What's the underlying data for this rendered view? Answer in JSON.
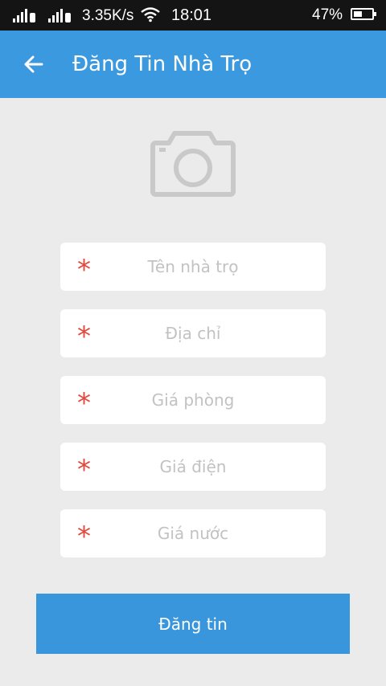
{
  "status_bar": {
    "sim1": "1",
    "sim2": "2",
    "network_speed": "3.35K/s",
    "time": "18:01",
    "battery_percent": "47%",
    "battery_level": 0.47
  },
  "app_bar": {
    "back_icon": "arrow-left-icon",
    "title": "Đăng Tin Nhà Trọ"
  },
  "photo": {
    "icon": "camera-icon"
  },
  "form": {
    "required_mark": "*",
    "fields": [
      {
        "placeholder": "Tên nhà trọ",
        "value": ""
      },
      {
        "placeholder": "Địa chỉ",
        "value": ""
      },
      {
        "placeholder": "Giá phòng",
        "value": ""
      },
      {
        "placeholder": "Giá điện",
        "value": ""
      },
      {
        "placeholder": "Giá nước",
        "value": ""
      }
    ]
  },
  "submit_label": "Đăng tin",
  "colors": {
    "app_bar": "#3b99df",
    "button": "#3996dc",
    "required": "#e2483d",
    "background": "#ebebeb"
  }
}
